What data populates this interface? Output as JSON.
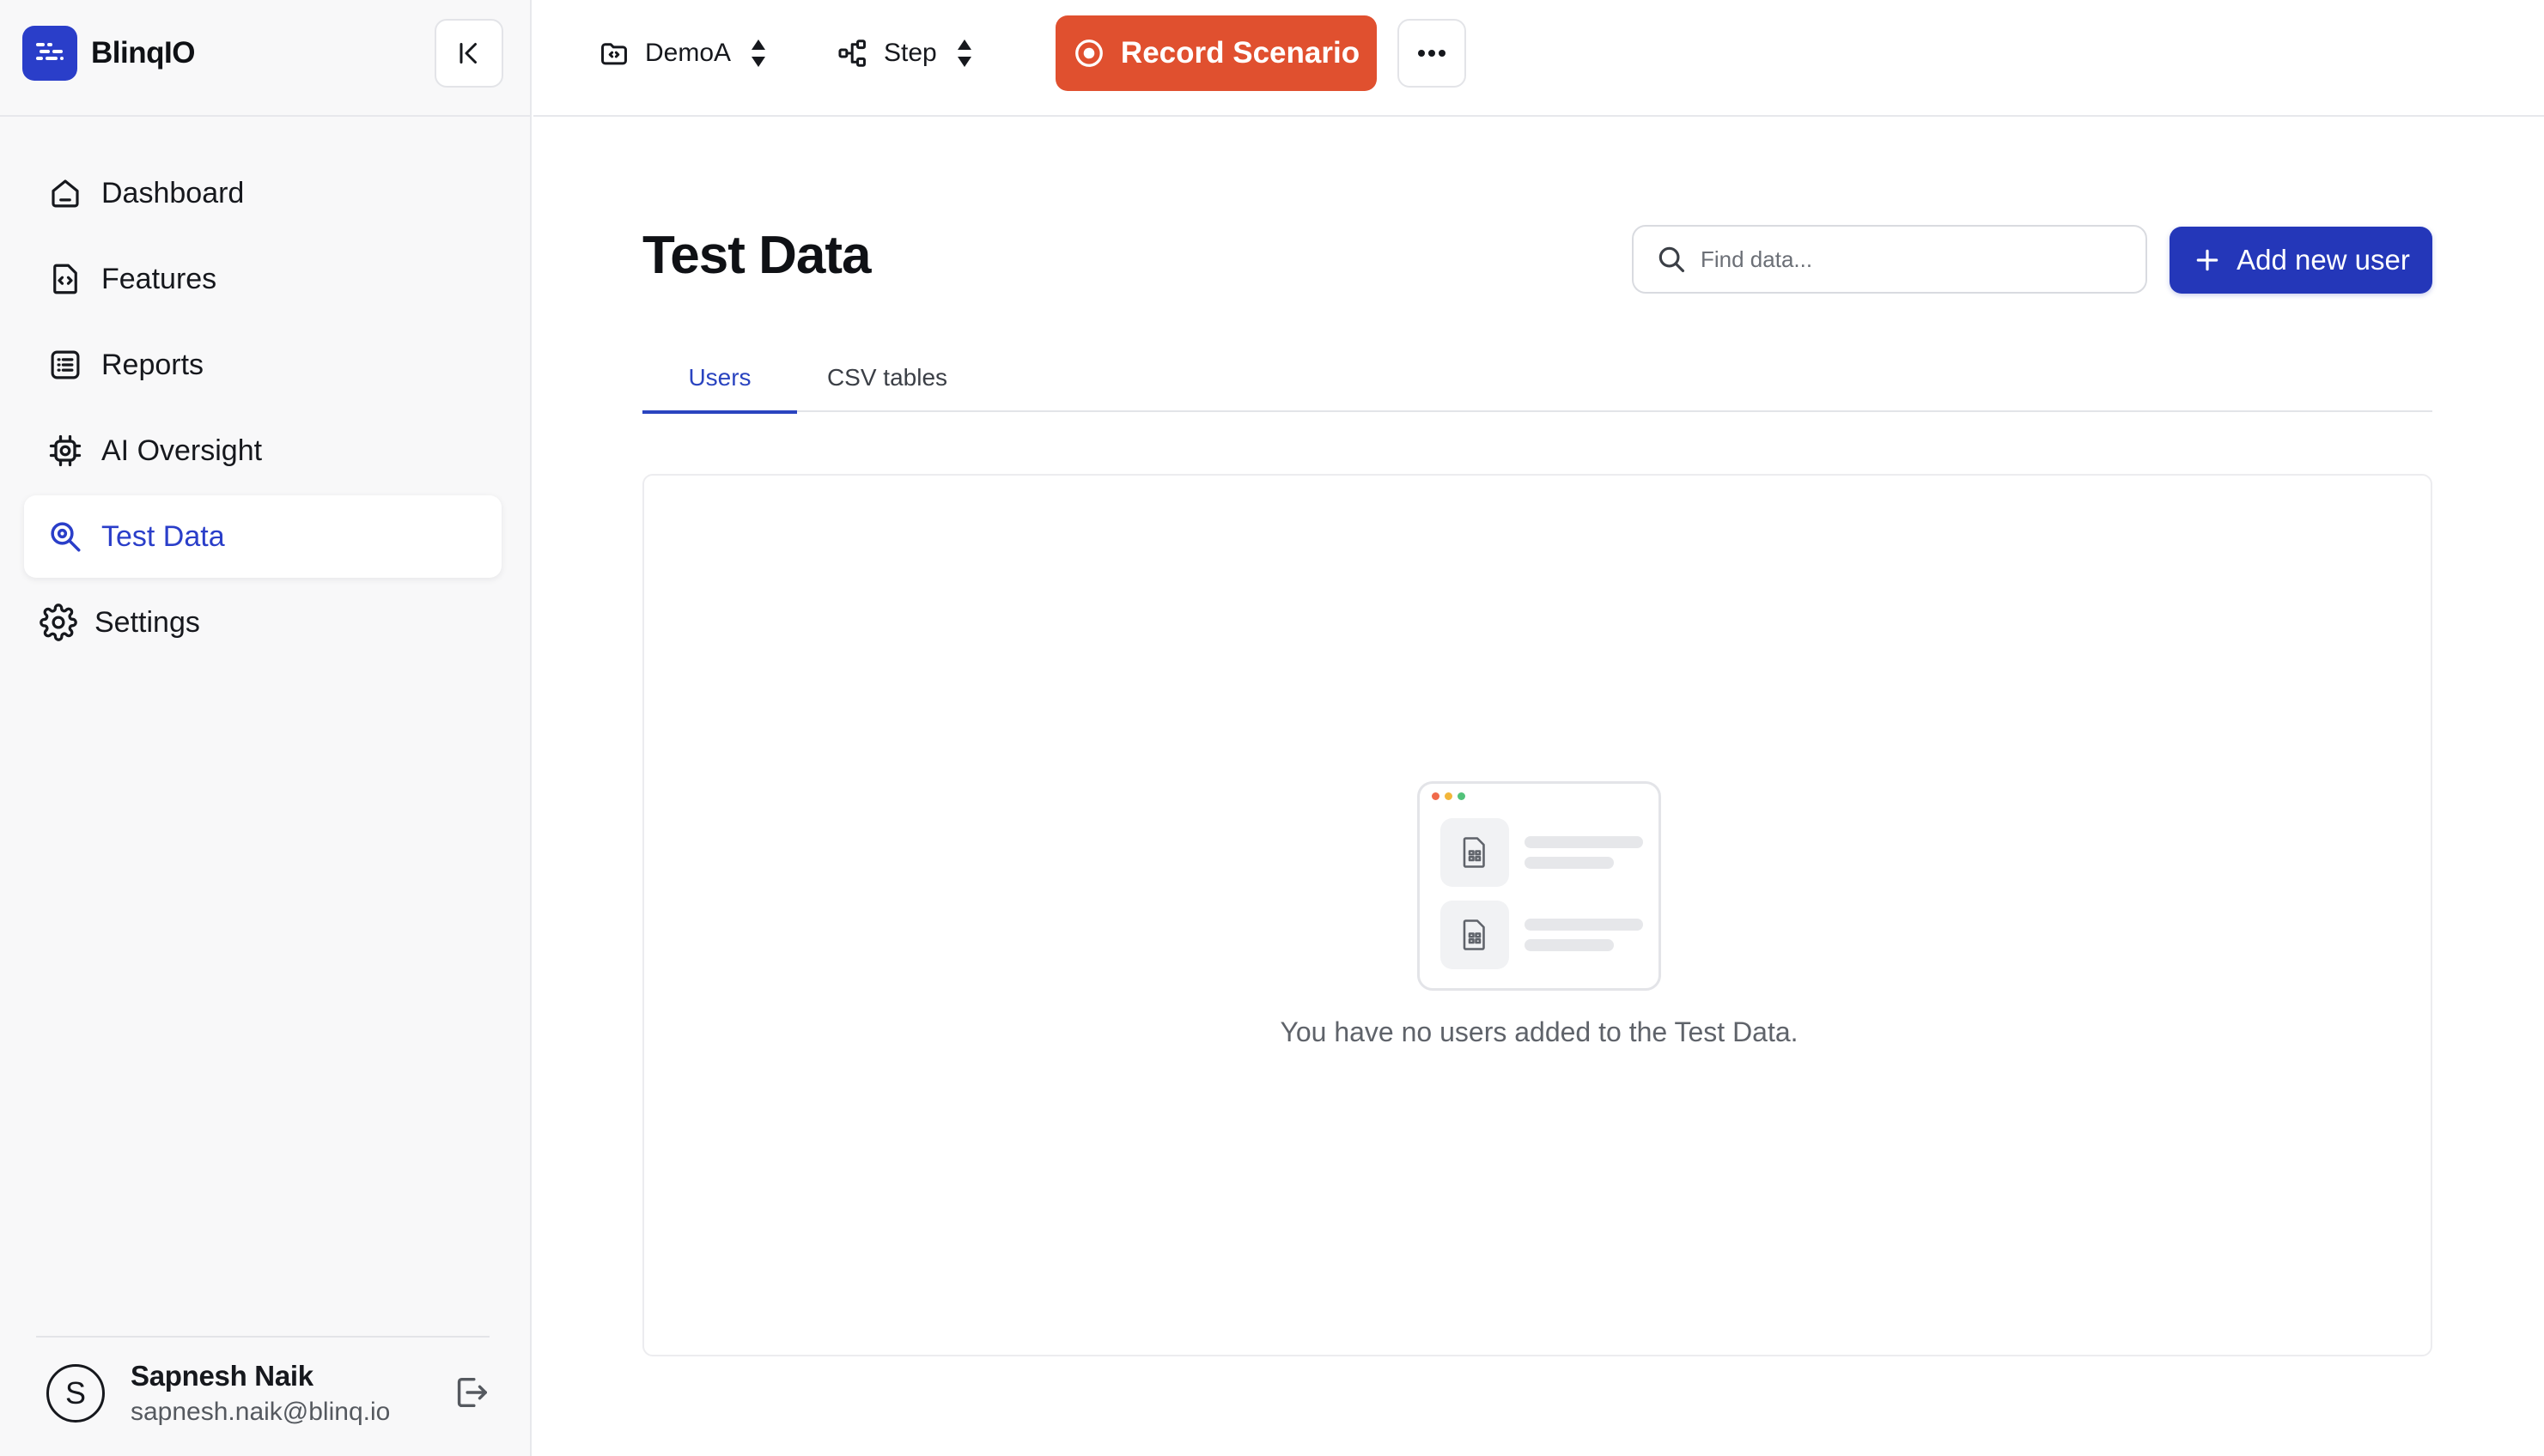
{
  "brand": {
    "name": "BlinqIO"
  },
  "sidebar": {
    "items": [
      {
        "label": "Dashboard",
        "icon": "home-icon"
      },
      {
        "label": "Features",
        "icon": "feature-file-icon"
      },
      {
        "label": "Reports",
        "icon": "reports-list-icon"
      },
      {
        "label": "AI Oversight",
        "icon": "ai-chip-icon"
      },
      {
        "label": "Test Data",
        "icon": "test-data-search-icon",
        "active": true
      },
      {
        "label": "Settings",
        "icon": "gear-icon"
      }
    ],
    "user": {
      "initial": "S",
      "name": "Sapnesh Naik",
      "email": "sapnesh.naik@blinq.io"
    }
  },
  "topbar": {
    "project": {
      "label": "DemoA",
      "icon": "project-icon"
    },
    "mode": {
      "label": "Step",
      "icon": "step-flow-icon"
    },
    "record_label": "Record Scenario"
  },
  "main": {
    "title": "Test Data",
    "search": {
      "placeholder": "Find data...",
      "value": ""
    },
    "add_label": "Add new user",
    "tabs": [
      {
        "label": "Users",
        "active": true
      },
      {
        "label": "CSV tables",
        "active": false
      }
    ],
    "empty_message": "You have no users added to the Test Data."
  },
  "colors": {
    "accent": "#2a3ec9",
    "record": "#e0502f",
    "sidebar_bg": "#f8f8f9",
    "dot_red": "#f06a4b",
    "dot_yellow": "#f2b63a",
    "dot_green": "#52c27a"
  }
}
